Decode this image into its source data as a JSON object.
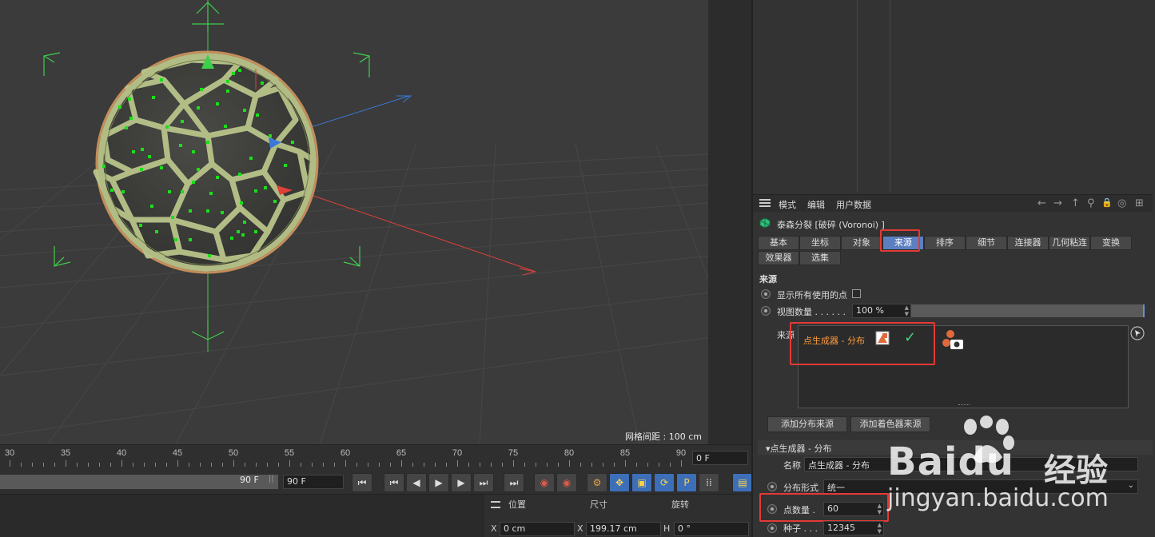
{
  "viewport": {
    "grid_spacing": "网格间距 : 100 cm"
  },
  "timeline": {
    "ticks": [
      "30",
      "35",
      "40",
      "45",
      "50",
      "55",
      "60",
      "65",
      "70",
      "75",
      "80",
      "85",
      "90"
    ],
    "current_frame": "0 F"
  },
  "transport": {
    "range_end": "90 F",
    "range_grip": "||",
    "frame_end": "90 F",
    "buttons": [
      {
        "name": "go-to-start-button",
        "glyph": "⏮"
      },
      {
        "name": "previous-key-button",
        "glyph": "⏮"
      },
      {
        "name": "previous-frame-button",
        "glyph": "◀"
      },
      {
        "name": "play-button",
        "glyph": "▶"
      },
      {
        "name": "next-frame-button",
        "glyph": "▶"
      },
      {
        "name": "next-key-button",
        "glyph": "⏭"
      },
      {
        "name": "go-to-end-button",
        "glyph": "⏭"
      },
      {
        "name": "record-button",
        "glyph": "◉"
      },
      {
        "name": "auto-key-button",
        "glyph": "◉"
      },
      {
        "name": "keyframe-selection-button",
        "glyph": "⚙"
      },
      {
        "name": "move-key-button",
        "glyph": "✥"
      },
      {
        "name": "scale-key-button",
        "glyph": "▣"
      },
      {
        "name": "rotate-key-button",
        "glyph": "⟳"
      },
      {
        "name": "parameter-key-button",
        "glyph": "P"
      },
      {
        "name": "point-level-button",
        "glyph": "⁞⁞"
      },
      {
        "name": "timeline-film-button",
        "glyph": "▤"
      }
    ]
  },
  "coords": {
    "headers": [
      "位置",
      "尺寸",
      "旋转"
    ],
    "x_label": "X",
    "x_position": "0 cm",
    "x_size_label": "X",
    "x_size": "199.17 cm",
    "h_label": "H",
    "h_rotation": "0 °"
  },
  "attribute_manager": {
    "menu": [
      "模式",
      "编辑",
      "用户数据"
    ],
    "nav_icons": [
      "←",
      "→",
      "↑",
      "⚲",
      "🔒",
      "◎",
      "⊞"
    ],
    "object_title": "泰森分裂 [破碎 (Voronoi) ]",
    "tabs_row1": [
      "基本",
      "坐标",
      "对象",
      "来源",
      "排序",
      "细节",
      "连接器",
      "几何粘连",
      "变换"
    ],
    "tabs_row2": [
      "效果器",
      "选集"
    ],
    "active_tab": "来源",
    "section_title": "来源",
    "show_all_points_label": "显示所有使用的点",
    "viewport_count_label": "视图数量 . . . . . .",
    "viewport_count_value": "100 %",
    "viewport_count_fraction": 1.0,
    "source_label": "来源",
    "source_item": "点生成器 - 分布",
    "add_distribution_source": "添加分布来源",
    "add_shader_source": "添加着色器来源",
    "subsection_title": "▾点生成器 - 分布",
    "name_label": "名称",
    "name_value": "点生成器 - 分布",
    "distribution_label": "分布形式",
    "distribution_value": "统一",
    "point_count_label": "点数量 .",
    "point_count_value": "60",
    "seed_label": "种子 . . .",
    "seed_value": "12345"
  },
  "watermark": {
    "brand": "Bai",
    "brand_du": "du",
    "brand_cn": "经验",
    "url": "jingyan.baidu.com"
  },
  "colors": {
    "accent_tab": "#5c7fc0",
    "highlight_box": "#e53935",
    "source_item": "#ff9a3c",
    "axis_x": "#e0403a",
    "axis_y": "#3ecf4a",
    "axis_z": "#3a78d8",
    "voronoi_mesh": "#b8c48a"
  }
}
